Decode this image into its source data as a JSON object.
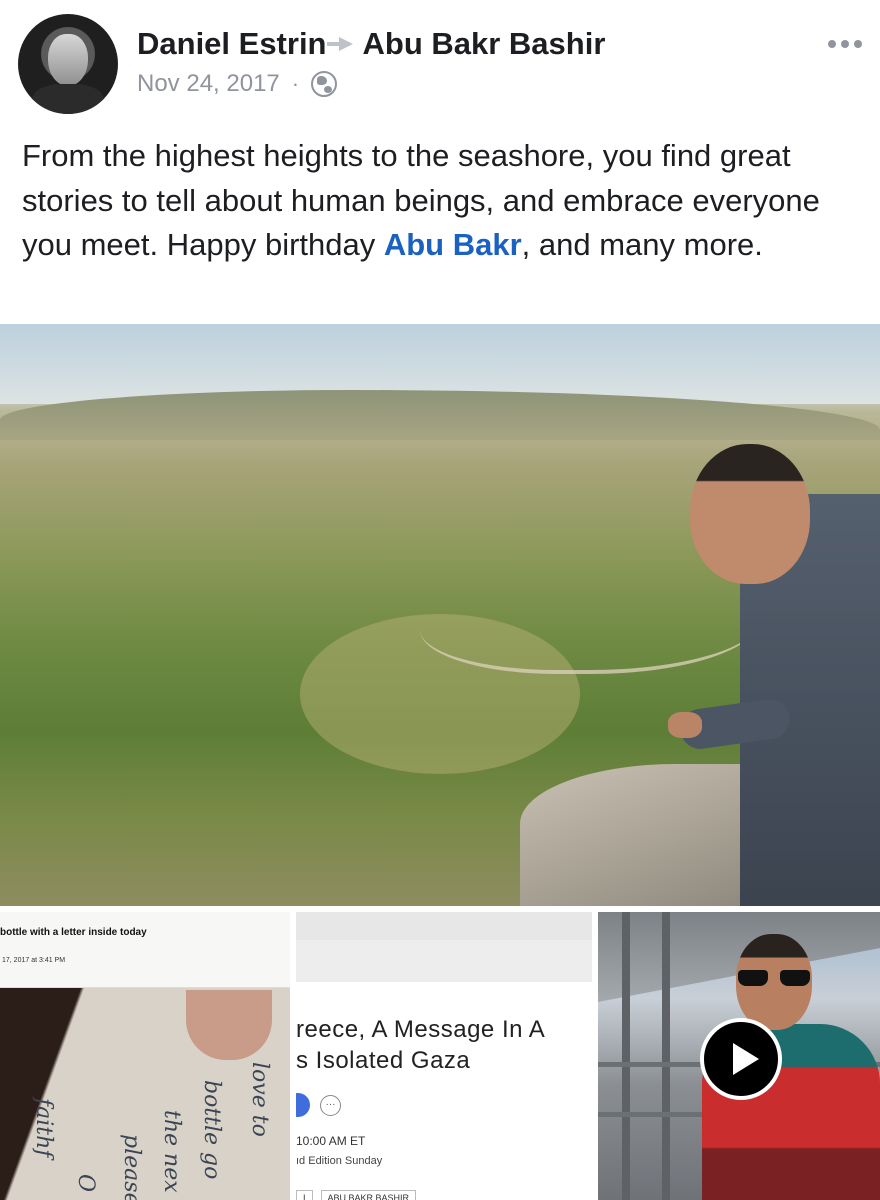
{
  "post": {
    "author": "Daniel Estrin",
    "target": "Abu Bakr Bashir",
    "date": "Nov 24, 2017",
    "separator": "·",
    "privacy_icon": "globe-icon",
    "text_before": "From the highest heights to the seashore, you find great stories to tell about human beings, and embrace everyone you meet. Happy birthday ",
    "mention": "Abu Bakr",
    "text_after": ", and many more."
  },
  "attachments": {
    "email": {
      "subject": "bottle with a letter inside today",
      "received": "17, 2017 at 3:41 PM",
      "handwriting": [
        "love to",
        "bottle go",
        "the nex",
        "please e",
        "O",
        "faithf"
      ]
    },
    "article": {
      "headline_line1": "reece, A Message In A",
      "headline_line2": "s Isolated Gaza",
      "time": "10:00 AM ET",
      "edition": "ıd Edition Sunday",
      "tag1": "I",
      "tag2": "ABU BAKR BASHIR"
    },
    "video": {
      "play_icon": "play-icon"
    }
  },
  "colors": {
    "mention": "#1b61c1",
    "meta": "#90949c"
  }
}
